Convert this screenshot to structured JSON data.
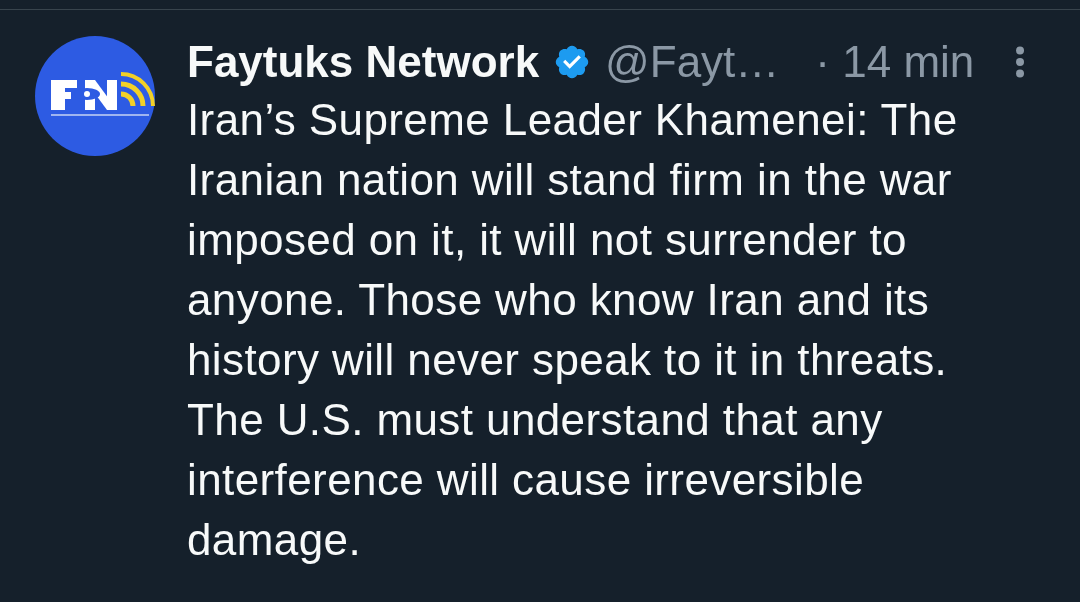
{
  "post": {
    "author": {
      "name": "Faytuks Network",
      "verified": true,
      "handle": "@Fayt…"
    },
    "time": "· 14 min",
    "text": "Iran’s Supreme Leader Khamenei: The Iranian nation will stand firm in the war imposed on it, it will not surrender to anyone. Those who know Iran and its history will never speak to it in threats. The U.S. must understand that any interference will cause irreversible damage."
  }
}
